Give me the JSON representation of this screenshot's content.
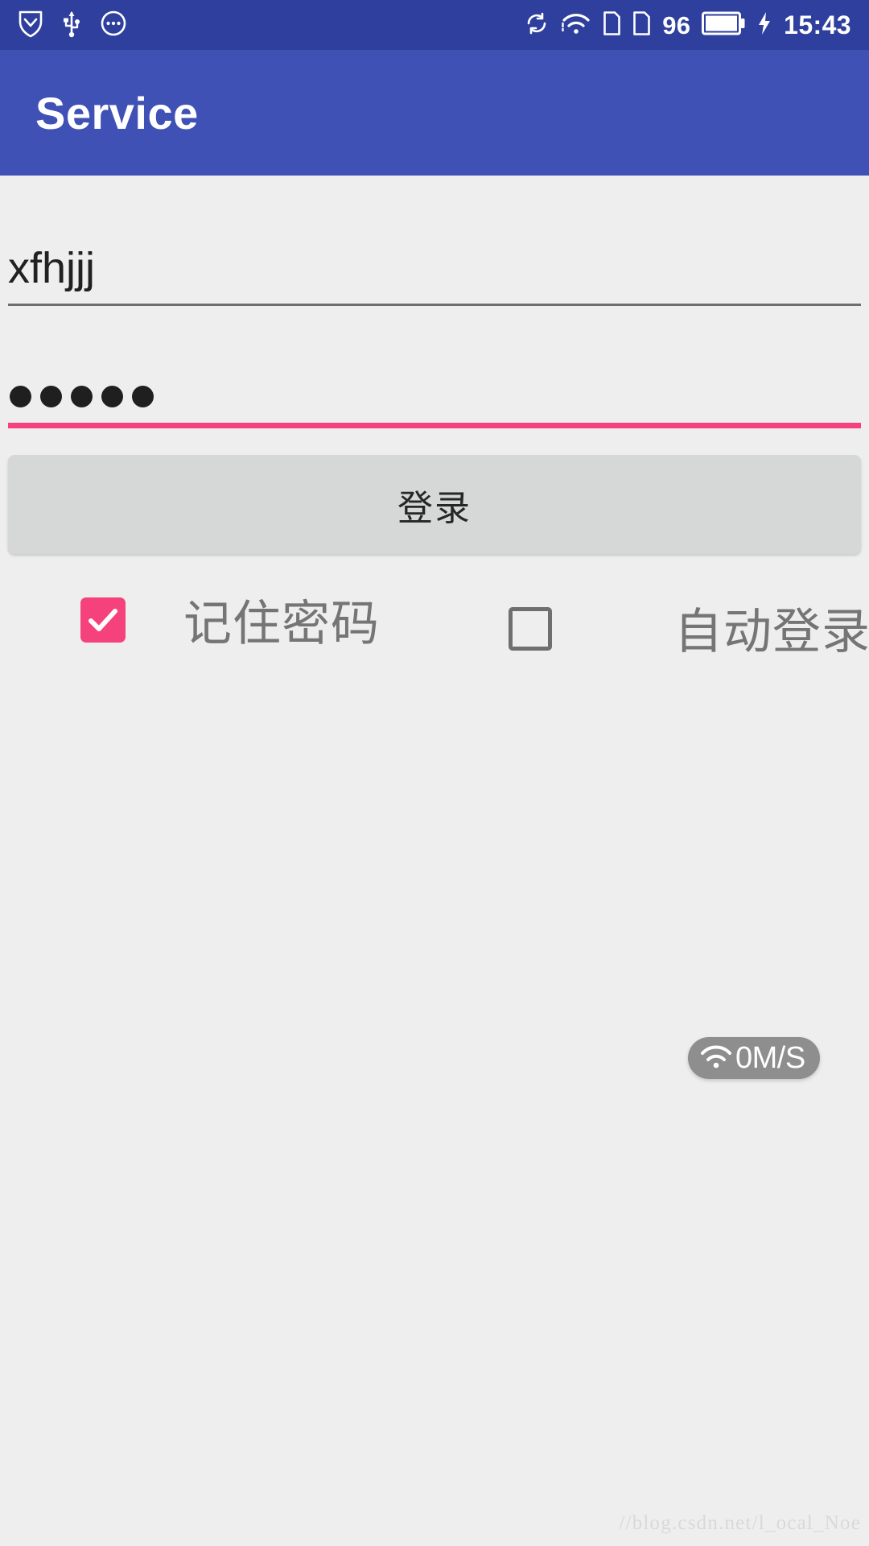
{
  "status_bar": {
    "background": "#2f3f9e",
    "left_icons": [
      "download-shield-icon",
      "usb-icon",
      "more-circle-icon"
    ],
    "right_icons": [
      "sync-icon",
      "wifi-icon",
      "sim1-icon",
      "sim2-icon"
    ],
    "battery_level": "96",
    "battery_icon": "battery-full-icon",
    "charging_icon": "charging-bolt-icon",
    "clock": "15:43"
  },
  "app_bar": {
    "title": "Service",
    "background": "#3f51b5"
  },
  "form": {
    "username": {
      "value": "xfhjjj",
      "placeholder": "",
      "underline_color": "#6e6e6e"
    },
    "password": {
      "value": "•••••",
      "masked_char_count": 5,
      "placeholder": "",
      "underline_color": "#f5417c",
      "focused": true
    },
    "login_button": {
      "label": "登录",
      "background": "#d6d7d7",
      "text_color": "#262626"
    },
    "checkboxes": [
      {
        "name": "remember-password",
        "label": "记住密码",
        "checked": true,
        "accent_color": "#f5417c"
      },
      {
        "name": "auto-login",
        "label": "自动登录",
        "checked": false,
        "border_color": "#6f6f6f"
      }
    ]
  },
  "overlay": {
    "net_speed": {
      "icon": "wifi-icon",
      "label": "0M/S",
      "background": "#8e8e8e"
    },
    "watermark": "//blog.csdn.net/l_ocal_Noe"
  }
}
